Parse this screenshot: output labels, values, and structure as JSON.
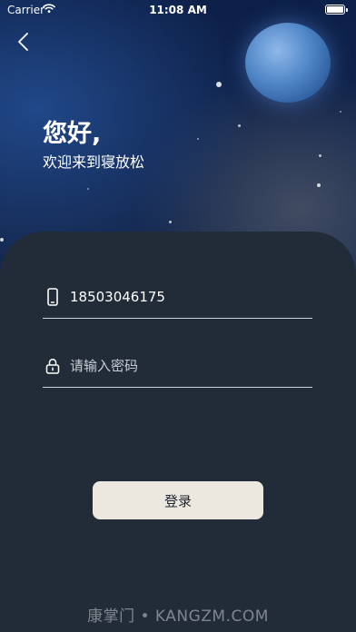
{
  "status_bar": {
    "carrier": "Carrier",
    "time": "11:08 AM"
  },
  "greeting": {
    "title": "您好,",
    "subtitle": "欢迎来到寝放松"
  },
  "form": {
    "phone_value": "18503046175",
    "password_placeholder": "请输入密码",
    "login_label": "登录"
  },
  "watermark": "康掌门 • KANGZM.COM",
  "icons": {
    "back": "chevron-left-icon",
    "phone": "phone-icon",
    "lock": "lock-icon",
    "wifi": "wifi-icon",
    "battery": "battery-icon"
  },
  "colors": {
    "panel": "#222c39",
    "button": "#ece8df",
    "moon": "#4f86c6"
  }
}
